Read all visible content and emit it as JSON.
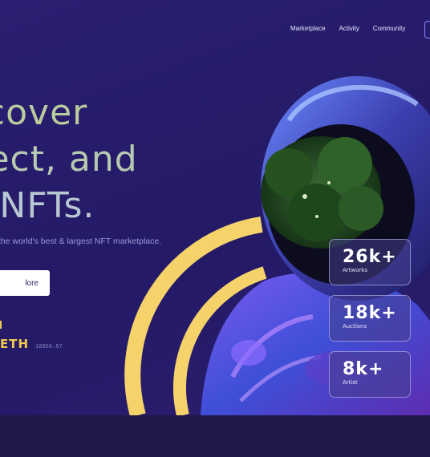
{
  "nav": {
    "items": [
      "Marketplace",
      "Activity",
      "Community"
    ]
  },
  "hero": {
    "headline_lines": [
      "scover",
      "llect, and",
      "ll NFTs."
    ],
    "subtext": "the world's best & largest NFT marketplace.",
    "explore_label": "lore"
  },
  "eth": {
    "label": "ETH",
    "value": "10056.87"
  },
  "stats": [
    {
      "value": "26k+",
      "label": "Artworks"
    },
    {
      "value": "18k+",
      "label": "Auctions"
    },
    {
      "value": "8k+",
      "label": "Artist"
    }
  ],
  "colors": {
    "accent": "#f2c94c",
    "background": "#2a1f72",
    "button": "#ffffff"
  }
}
